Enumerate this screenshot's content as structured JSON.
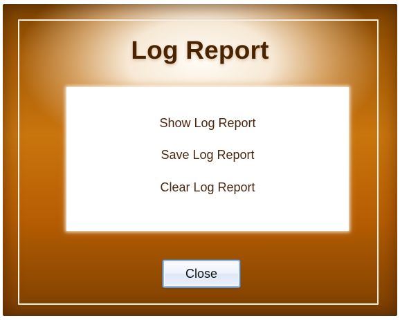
{
  "dialog": {
    "title": "Log Report",
    "menu": {
      "items": [
        {
          "label": "Show Log Report"
        },
        {
          "label": "Save Log Report"
        },
        {
          "label": "Clear Log Report"
        }
      ]
    },
    "close_label": "Close"
  },
  "colors": {
    "frame_dark": "#7b4200",
    "frame_mid": "#c9750e",
    "title_text": "#4a2400",
    "menu_text": "#4b260f",
    "panel_bg": "#ffffff",
    "button_focus": "#8bb7ea"
  }
}
